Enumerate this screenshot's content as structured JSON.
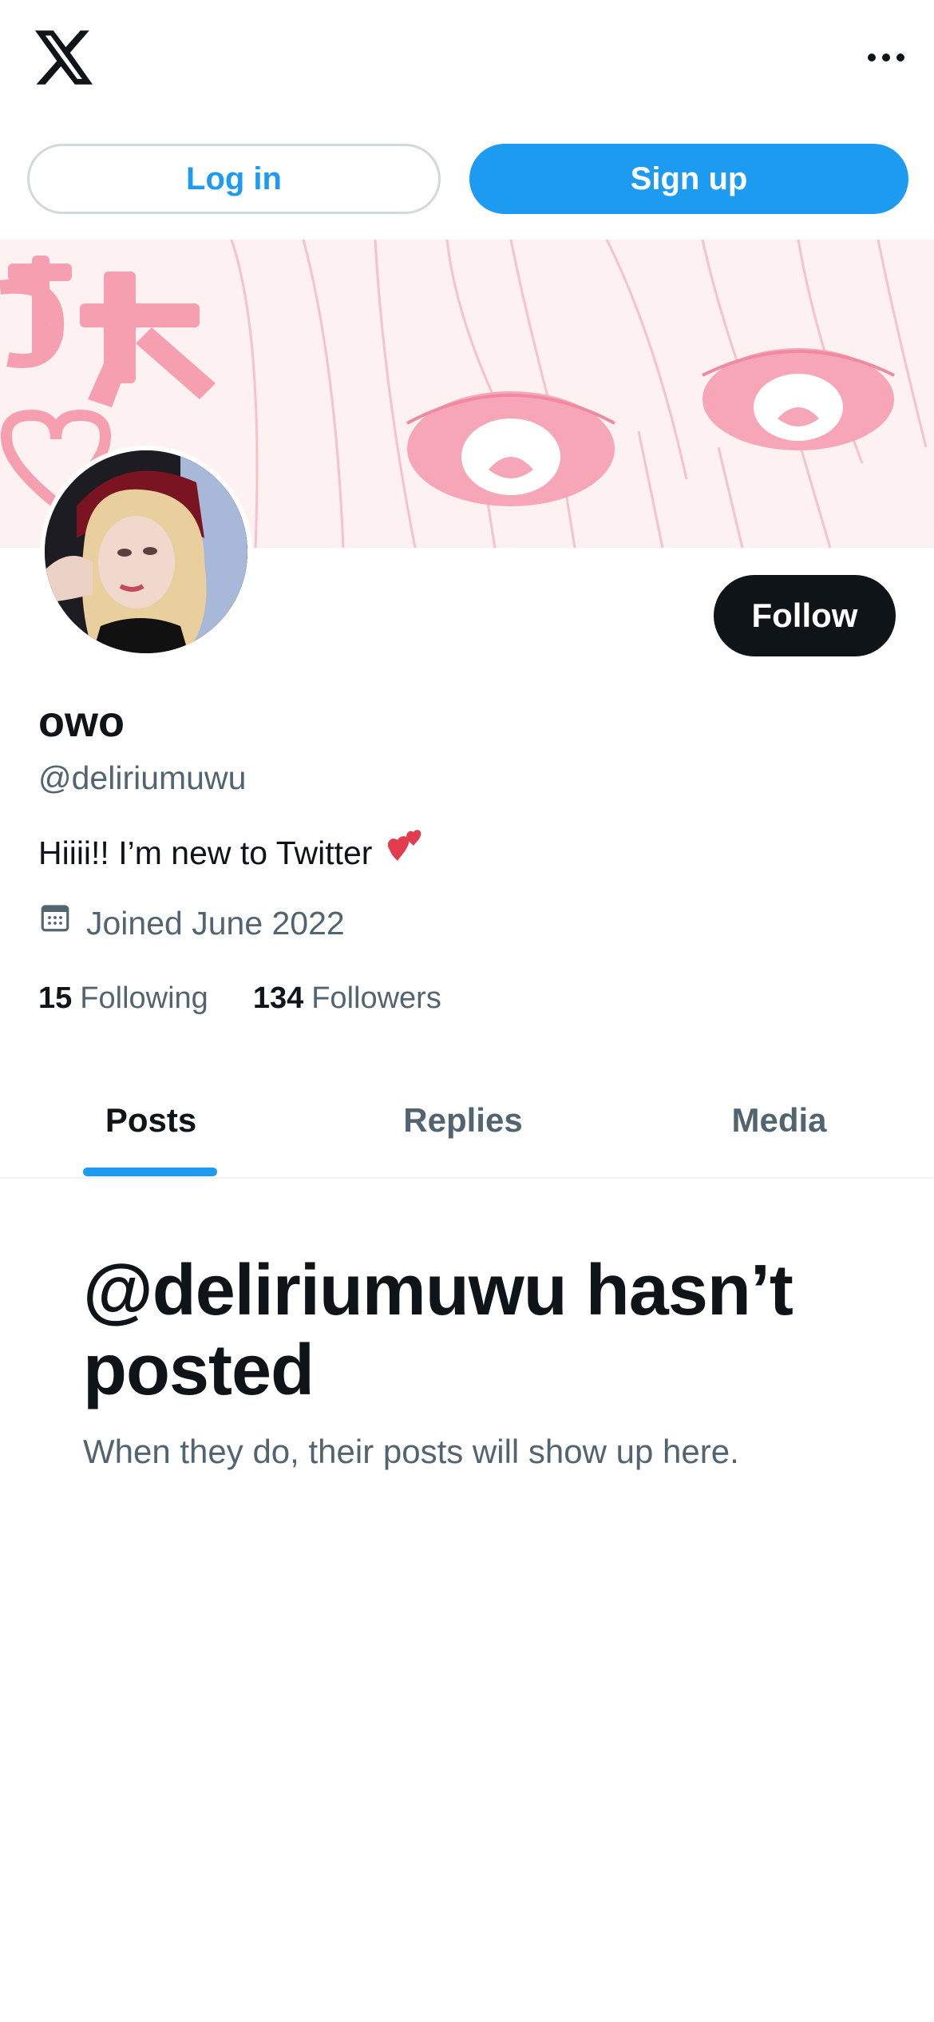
{
  "header": {
    "logo": "x-logo-icon",
    "more_icon": "more-horizontal-icon"
  },
  "auth": {
    "login_label": "Log in",
    "signup_label": "Sign up"
  },
  "profile": {
    "display_name": "owo",
    "handle": "@deliriumuwu",
    "bio_text": "Hiiii!! I’m new to Twitter",
    "bio_emoji": "💕",
    "joined": "Joined June 2022",
    "following_count": "15",
    "following_label": "Following",
    "followers_count": "134",
    "followers_label": "Followers",
    "follow_label": "Follow"
  },
  "tabs": [
    {
      "label": "Posts",
      "active": true
    },
    {
      "label": "Replies",
      "active": false
    },
    {
      "label": "Media",
      "active": false
    }
  ],
  "empty_state": {
    "title": "@deliriumuwu hasn’t posted",
    "subtitle": "When they do, their posts will show up here."
  },
  "colors": {
    "accent": "#1d9bf0",
    "text_primary": "#0f1419",
    "text_secondary": "#536471",
    "banner_pink": "#f2a0b3"
  }
}
